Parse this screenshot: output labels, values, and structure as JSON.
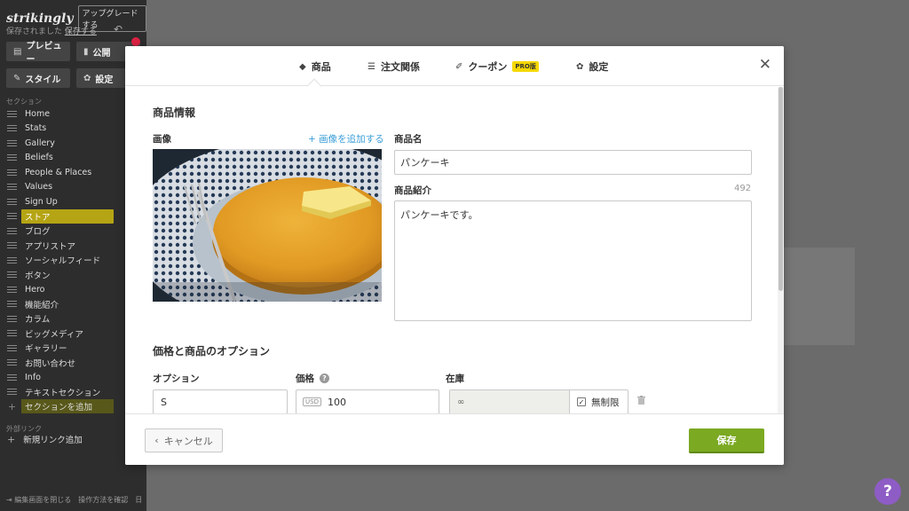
{
  "sidebar": {
    "logo": "strikingly",
    "upgrade_label": "アップグレードする",
    "saved_text": "保存されました",
    "save_link": "保存する",
    "preview_label": "プレビュー",
    "publish_label": "公開",
    "style_label": "スタイル",
    "settings_label": "設定",
    "section_header": "セクション",
    "items": [
      {
        "label": "Home"
      },
      {
        "label": "Stats"
      },
      {
        "label": "Gallery"
      },
      {
        "label": "Beliefs"
      },
      {
        "label": "People & Places"
      },
      {
        "label": "Values"
      },
      {
        "label": "Sign Up"
      },
      {
        "label": "ストア"
      },
      {
        "label": "ブログ"
      },
      {
        "label": "アプリストア"
      },
      {
        "label": "ソーシャルフィード"
      },
      {
        "label": "ボタン"
      },
      {
        "label": "Hero"
      },
      {
        "label": "機能紹介"
      },
      {
        "label": "カラム"
      },
      {
        "label": "ビッグメディア"
      },
      {
        "label": "ギャラリー"
      },
      {
        "label": "お問い合わせ"
      },
      {
        "label": "Info"
      },
      {
        "label": "テキストセクション"
      }
    ],
    "add_section_label": "セクションを追加",
    "external_header": "外部リンク",
    "add_link_label": "新規リンク追加",
    "footer_close": "編集画面を閉じる",
    "footer_howto": "操作方法を確認",
    "footer_lang": "日"
  },
  "modal": {
    "tabs": [
      {
        "label": "商品",
        "icon": "tag-icon"
      },
      {
        "label": "注文関係",
        "icon": "list-icon"
      },
      {
        "label": "クーポン",
        "icon": "ticket-icon"
      },
      {
        "label": "設定",
        "icon": "gear-icon"
      }
    ],
    "pro_badge": "PRO版",
    "product_info_title": "商品情報",
    "image_label": "画像",
    "add_image_link": "+ 画像を追加する",
    "product_name_label": "商品名",
    "product_name_value": "パンケーキ",
    "description_label": "商品紹介",
    "description_count": "492",
    "description_value": "パンケーキです。",
    "options_title": "価格と商品のオプション",
    "option_label": "オプション",
    "price_label": "価格",
    "stock_label": "在庫",
    "option_value": "S",
    "currency": "USD",
    "price_value": "100",
    "stock_value": "∞",
    "unlimited_label": "無制限",
    "cancel_label": "キャンセル",
    "save_label": "保存"
  },
  "help_fab": "?",
  "colors": {
    "accent_green": "#7ba922",
    "link_blue": "#3b9ed8",
    "active_section": "#b5a414",
    "help_purple": "#8e5cc5"
  }
}
